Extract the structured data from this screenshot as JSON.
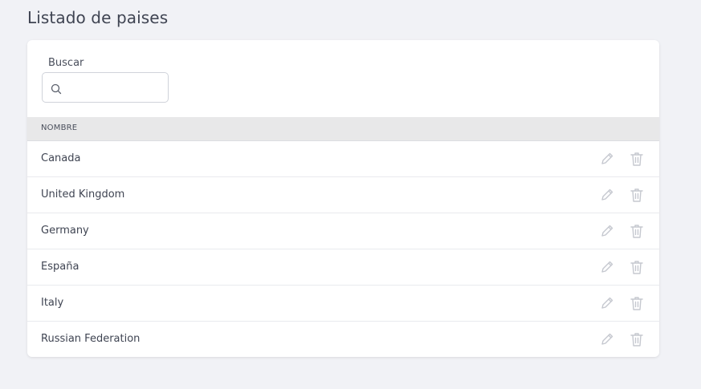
{
  "page": {
    "title": "Listado de paises"
  },
  "search": {
    "label": "Buscar",
    "value": "",
    "icon": "search-icon"
  },
  "table": {
    "column_header": "NOMBRE",
    "rows": [
      {
        "name": "Canada"
      },
      {
        "name": "United Kingdom"
      },
      {
        "name": "Germany"
      },
      {
        "name": "España"
      },
      {
        "name": "Italy"
      },
      {
        "name": "Russian Federation"
      }
    ],
    "row_actions": [
      "pencil-icon",
      "trash-icon"
    ]
  },
  "colors": {
    "background": "#f1f2f6",
    "card": "#ffffff",
    "header_bg": "#e8e8e9",
    "icon": "#c5c8cf"
  }
}
